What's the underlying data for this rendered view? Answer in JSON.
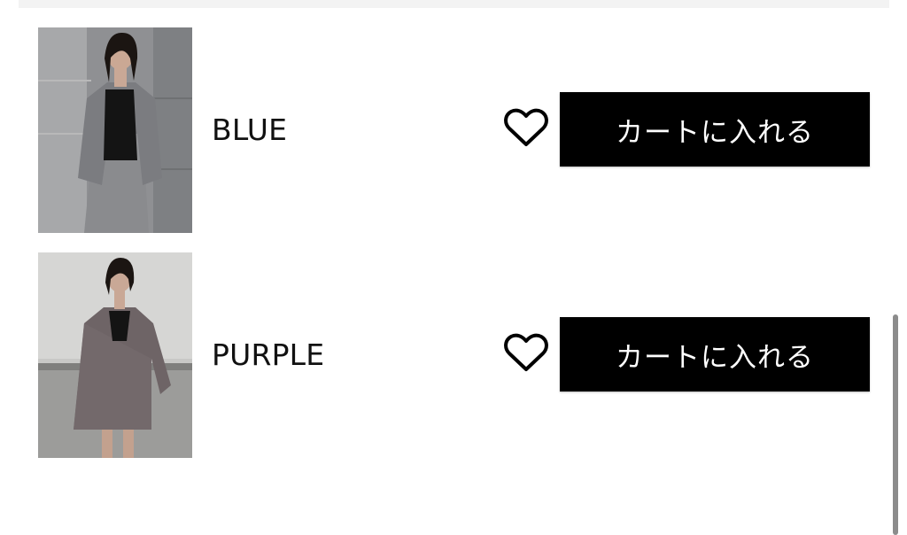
{
  "items": [
    {
      "color": "BLUE",
      "image_desc": "model-gray-jacket-black-top",
      "favorite_icon": "heart-outline-icon",
      "cart_label": "カートに入れる"
    },
    {
      "color": "PURPLE",
      "image_desc": "model-tweed-jacket-skirt",
      "favorite_icon": "heart-outline-icon",
      "cart_label": "カートに入れる"
    }
  ],
  "colors": {
    "button_bg": "#000000",
    "button_text": "#ffffff",
    "label_text": "#111111",
    "scrollbar": "#8c8c8c"
  }
}
